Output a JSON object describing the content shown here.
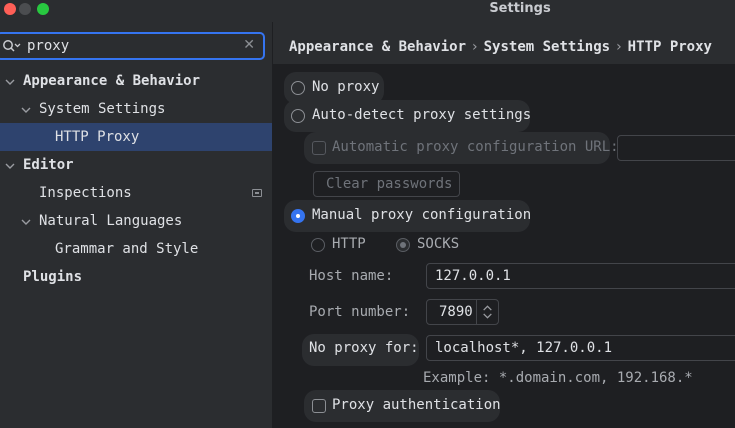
{
  "window": {
    "title": "Settings"
  },
  "search": {
    "value": "proxy"
  },
  "sidebar": {
    "items": [
      {
        "label": "Appearance & Behavior"
      },
      {
        "label": "System Settings"
      },
      {
        "label": "HTTP Proxy"
      },
      {
        "label": "Editor"
      },
      {
        "label": "Inspections"
      },
      {
        "label": "Natural Languages"
      },
      {
        "label": "Grammar and Style"
      },
      {
        "label": "Plugins"
      }
    ]
  },
  "breadcrumb": [
    "Appearance & Behavior",
    "System Settings",
    "HTTP Proxy"
  ],
  "proxy": {
    "no_proxy": "No proxy",
    "auto_detect": "Auto-detect proxy settings",
    "auto_config_url": "Automatic proxy configuration URL:",
    "clear_passwords": "Clear passwords",
    "manual": "Manual proxy configuration",
    "type_http": "HTTP",
    "type_socks": "SOCKS",
    "host_label": "Host name:",
    "host_value": "127.0.0.1",
    "port_label": "Port number:",
    "port_value": "7890",
    "no_proxy_for_label": "No proxy for:",
    "no_proxy_for_value": "localhost*, 127.0.0.1",
    "example": "Example: *.domain.com, 192.168.*",
    "proxy_auth": "Proxy authentication"
  },
  "colors": {
    "accent": "#3574f0",
    "selection": "#2e436e",
    "background": "#2b2d30",
    "panel": "#1e1f22"
  }
}
